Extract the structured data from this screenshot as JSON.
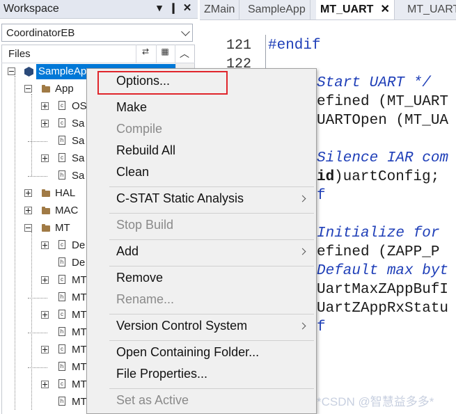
{
  "workspace": {
    "title": "Workspace",
    "pin_glyph": "▾",
    "lock_glyph": "❙",
    "close_glyph": "✕",
    "configuration": "CoordinatorEB",
    "files_header": "Files",
    "tree": {
      "project": "SampleApp",
      "folders": [
        "App",
        "HAL",
        "MAC",
        "MT"
      ],
      "app_children": [
        "OS",
        "Sa",
        "Sa",
        "Sa",
        "Sa"
      ],
      "mt_children": [
        "De",
        "De",
        "MT",
        "MT",
        "MT",
        "MT",
        "MT",
        "MT",
        "MT",
        "MT"
      ]
    }
  },
  "editor": {
    "tabs": [
      "ZMain",
      "SampleApp",
      "MT_UART",
      "MT_UART"
    ],
    "active_tab_close": "✕",
    "line_numbers": [
      "121",
      "122"
    ],
    "lines": {
      "l1": "#endif",
      "l2": "Start UART */",
      "l3": "efined (MT_UART",
      "l4": "UARTOpen (MT_UA",
      "l5": "Silence IAR com",
      "l6a": "id",
      "l6b": ")uartConfig;",
      "l7": "f",
      "l8": "Initialize for",
      "l9": "efined (ZAPP_P",
      "l10": "Default max byt",
      "l11": "UartMaxZAppBufI",
      "l12": "UartZAppRxStatu",
      "l13": "f"
    },
    "watermark": "*CSDN @智慧益多多*"
  },
  "context_menu": {
    "options": "Options...",
    "make": "Make",
    "compile": "Compile",
    "rebuild_all": "Rebuild All",
    "clean": "Clean",
    "cstat": "C-STAT Static Analysis",
    "stop_build": "Stop Build",
    "add": "Add",
    "remove": "Remove",
    "rename": "Rename...",
    "version_control": "Version Control System",
    "open_folder": "Open Containing Folder...",
    "file_properties": "File Properties...",
    "set_active": "Set as Active"
  },
  "colors": {
    "highlight_box": "#e0252b",
    "selection": "#0078d7",
    "keyword": "#1f3fb8"
  }
}
